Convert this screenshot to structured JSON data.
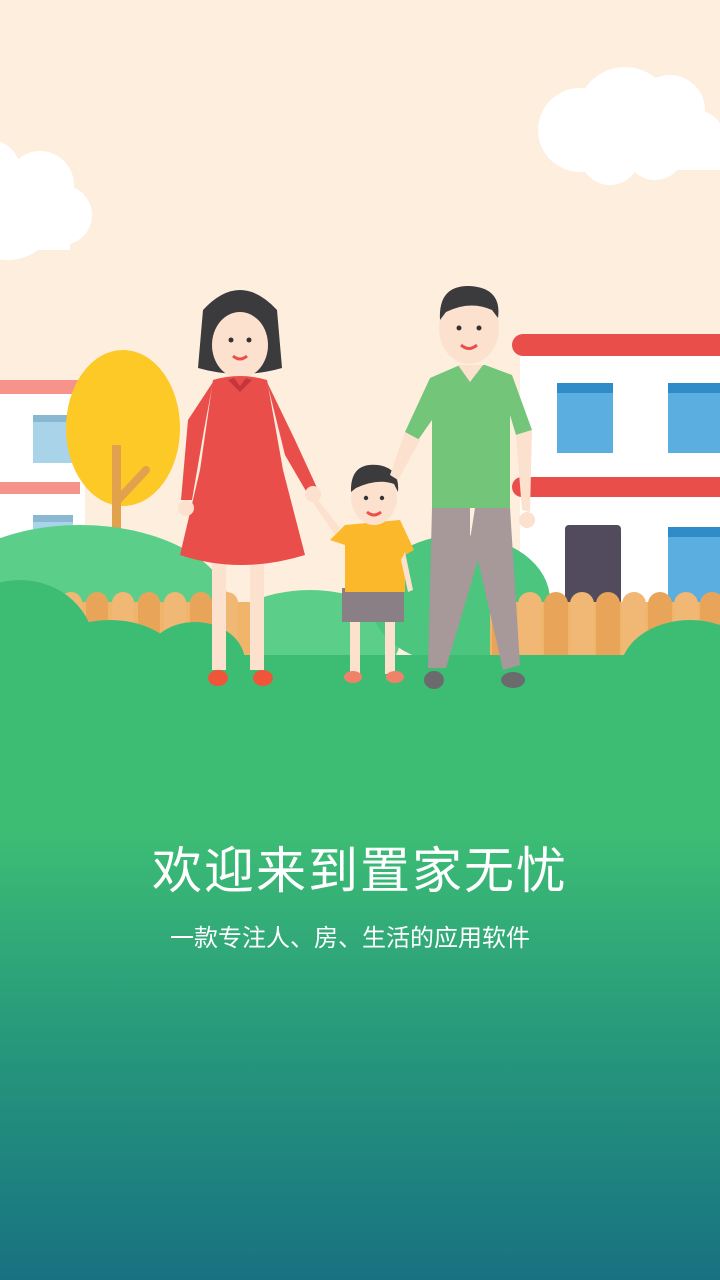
{
  "welcome": {
    "title": "欢迎来到置家无忧",
    "subtitle": "一款专注人、房、生活的应用软件"
  },
  "illustration": {
    "name": "family-house-illustration",
    "elements": [
      "cloud-left",
      "cloud-right",
      "tree",
      "house-left",
      "house-right",
      "fence",
      "mother",
      "child",
      "father",
      "bushes"
    ]
  },
  "colors": {
    "sky": "#fdeedd",
    "grass_top": "#3dbd74",
    "grass_bottom": "#187181",
    "roof_red": "#e94e4b",
    "window_blue": "#5aaee0",
    "dress_red": "#ea4e4a",
    "shirt_green": "#73c679",
    "child_shirt": "#fbb82a",
    "tree_yellow": "#fcc927",
    "fence": "#e8a55a"
  }
}
